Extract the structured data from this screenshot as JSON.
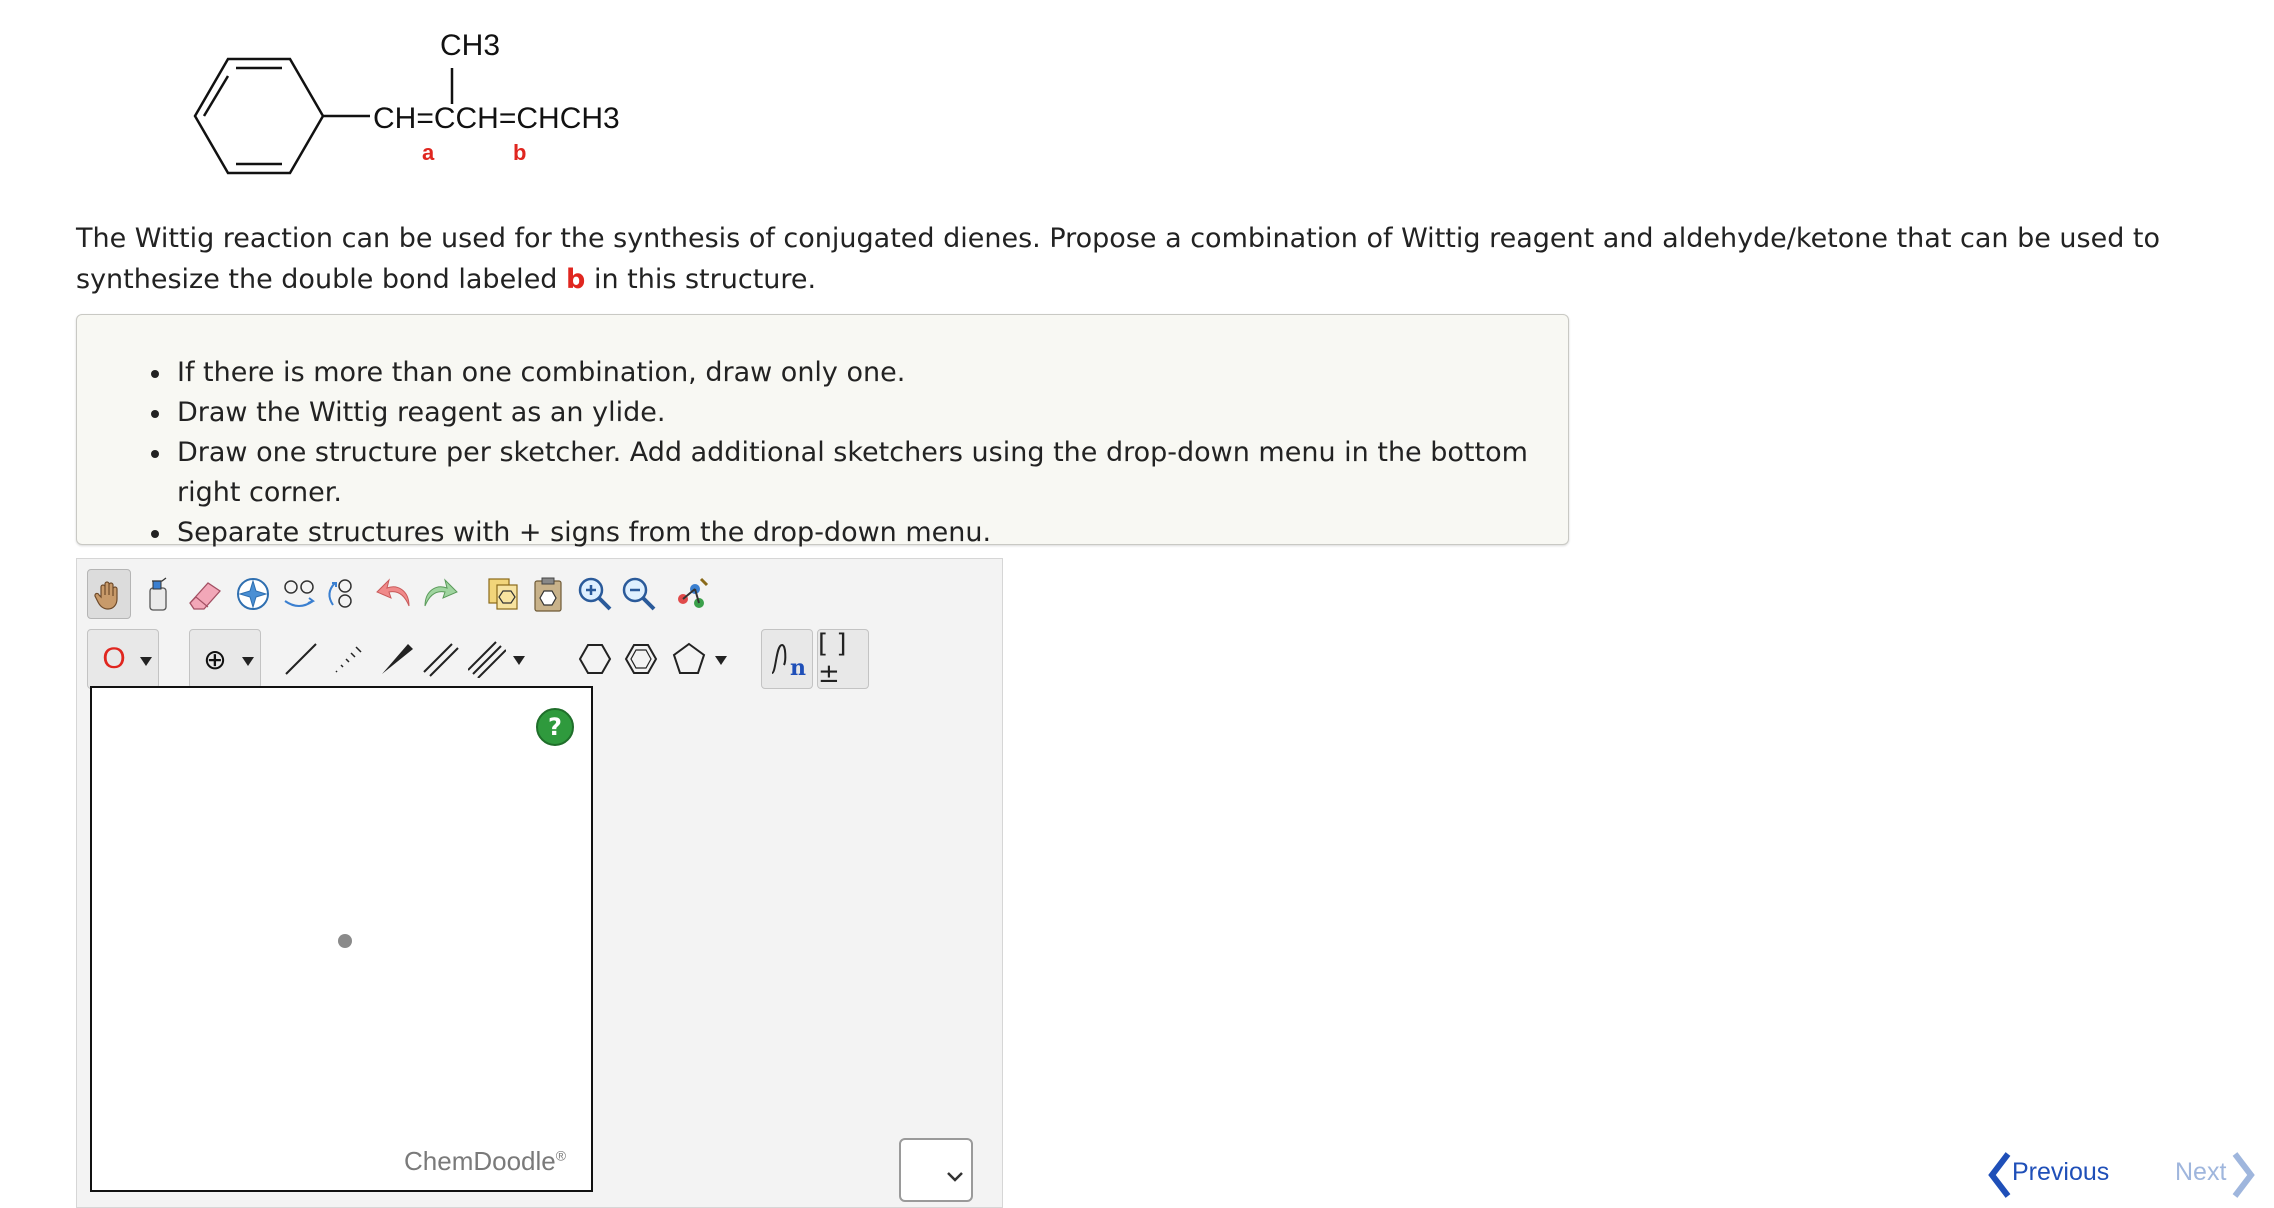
{
  "structure": {
    "methyl_label": "CH3",
    "chain_label": "CH=CCH=CHCH3",
    "label_a": "a",
    "label_b": "b"
  },
  "question": {
    "text_before": "The Wittig reaction can be used for the synthesis of conjugated dienes. Propose a combination of Wittig reagent and aldehyde/ketone that can be used to synthesize the double bond labeled ",
    "highlight": "b",
    "text_after": " in this structure."
  },
  "instructions": [
    "If there is more than one combination, draw only one.",
    "Draw the Wittig reagent as an ylide.",
    "Draw one structure per sketcher. Add additional sketchers using the drop-down menu in the bottom right corner.",
    "Separate structures with + signs from the drop-down menu."
  ],
  "toolbar": {
    "atom_label": "O",
    "charge_label": "⊕",
    "bracket_label": "[ ]±"
  },
  "sketcher": {
    "help_label": "?",
    "watermark": "ChemDoodle",
    "watermark_mark": "®"
  },
  "nav": {
    "previous": "Previous",
    "next": "Next"
  },
  "colors": {
    "highlight": "#e0261f",
    "link": "#1f4fb8",
    "link_disabled": "#9fb6dd"
  }
}
